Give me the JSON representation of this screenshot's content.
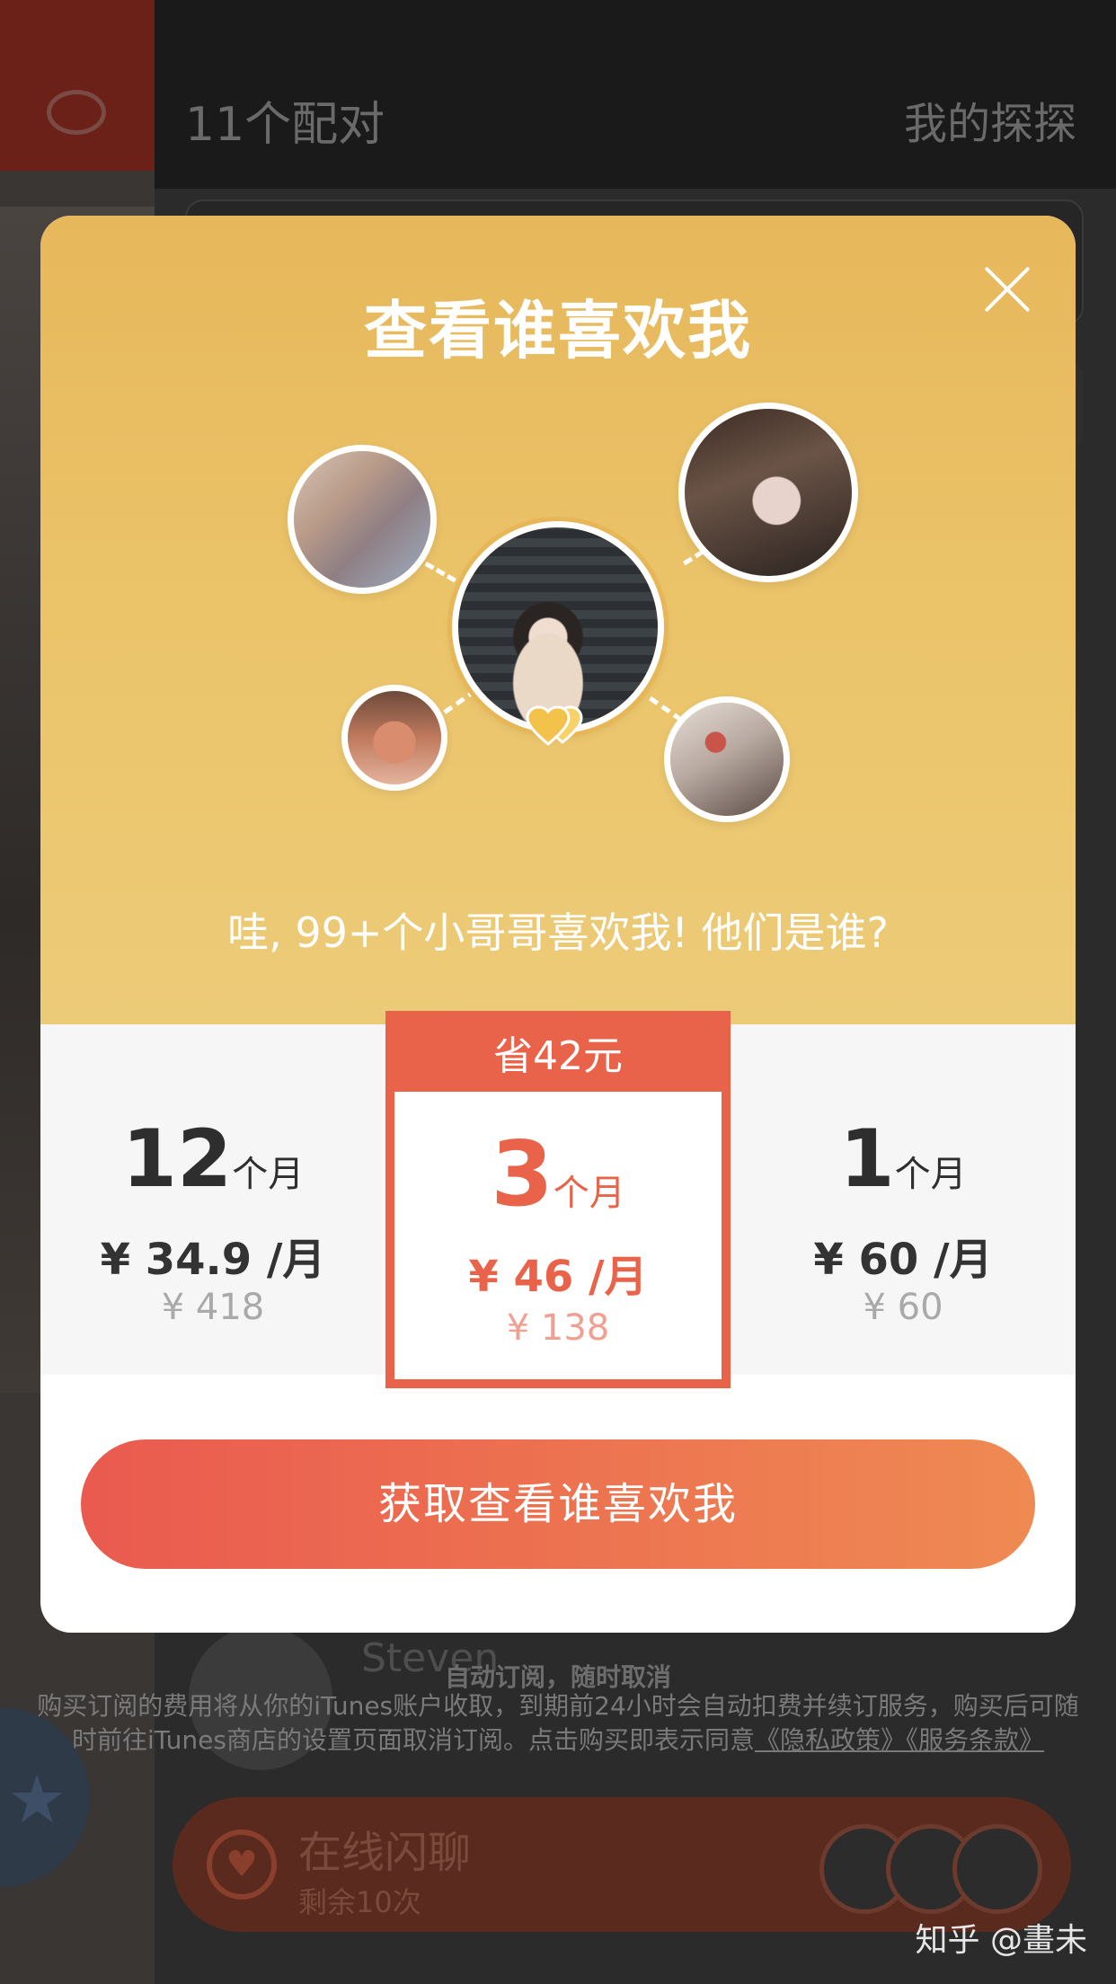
{
  "background": {
    "header_title": "11个配对",
    "header_right": "我的探探",
    "match_name": "Steven",
    "live_chat": {
      "title": "在线闪聊",
      "subtitle": "剩余10次"
    },
    "watermark": "知乎 @畫未"
  },
  "modal": {
    "title": "查看谁喜欢我",
    "subtitle": "哇, 99+个小哥哥喜欢我! 他们是谁?",
    "plans": [
      {
        "duration": "12",
        "unit": "个月",
        "price": "¥ 34.9 /月",
        "total": "¥ 418"
      },
      {
        "badge": "省42元",
        "duration": "3",
        "unit": "个月",
        "price": "¥ 46 /月",
        "total": "¥ 138",
        "selected": true
      },
      {
        "duration": "1",
        "unit": "个月",
        "price": "¥ 60 /月",
        "total": "¥ 60"
      }
    ],
    "cta_label": "获取查看谁喜欢我"
  },
  "fine_print": {
    "heading": "自动订阅，随时取消",
    "body": "购买订阅的费用将从你的iTunes账户收取，到期前24小时会自动扣费并续订服务，购买后可随时前往iTunes商店的设置页面取消订阅。点击购买即表示同意",
    "link_privacy": "《隐私政策》",
    "link_terms": "《服务条款》"
  },
  "colors": {
    "accent": "#e9634a",
    "gold": "#e7b75b",
    "cta_start": "#ea5a4f",
    "cta_end": "#ef8a52"
  }
}
